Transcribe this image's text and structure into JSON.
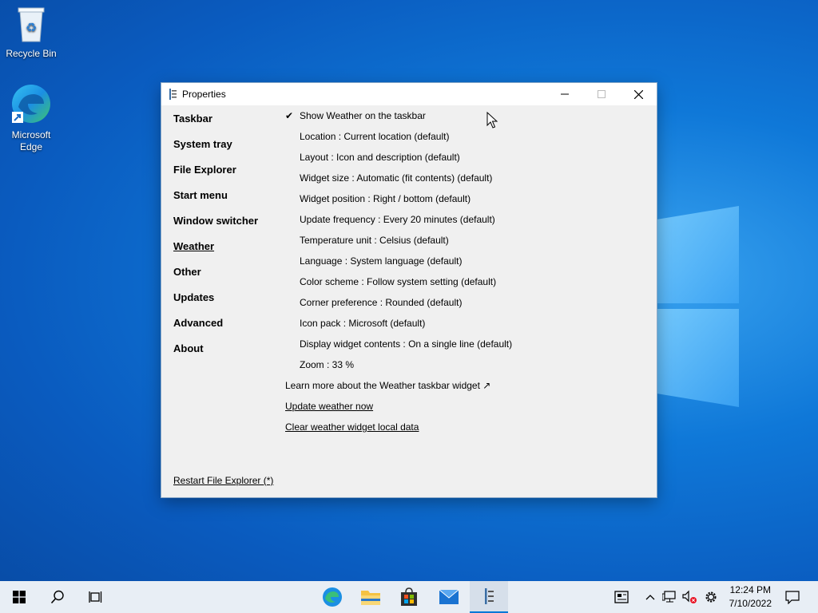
{
  "desktop": {
    "icons": [
      {
        "label": "Recycle Bin"
      },
      {
        "label": "Microsoft Edge",
        "label_line1": "Microsoft",
        "label_line2": "Edge"
      }
    ]
  },
  "window": {
    "title": "Properties",
    "nav": [
      {
        "label": "Taskbar"
      },
      {
        "label": "System tray"
      },
      {
        "label": "File Explorer"
      },
      {
        "label": "Start menu"
      },
      {
        "label": "Window switcher"
      },
      {
        "label": "Weather",
        "active": true
      },
      {
        "label": "Other"
      },
      {
        "label": "Updates"
      },
      {
        "label": "Advanced"
      },
      {
        "label": "About"
      }
    ],
    "options": [
      {
        "check": "✔",
        "label": "Show Weather on the taskbar"
      },
      {
        "label": "Location : Current location (default)"
      },
      {
        "label": "Layout : Icon and description (default)"
      },
      {
        "label": "Widget size : Automatic (fit contents) (default)"
      },
      {
        "label": "Widget position : Right / bottom (default)"
      },
      {
        "label": "Update frequency : Every 20 minutes (default)"
      },
      {
        "label": "Temperature unit : Celsius (default)"
      },
      {
        "label": "Language : System language (default)"
      },
      {
        "label": "Color scheme : Follow system setting (default)"
      },
      {
        "label": "Corner preference : Rounded (default)"
      },
      {
        "label": "Icon pack : Microsoft (default)"
      },
      {
        "label": "Display widget contents : On a single line (default)"
      },
      {
        "label": "Zoom : 33 %"
      }
    ],
    "links": {
      "learn_more": "Learn more about the Weather taskbar widget ↗",
      "update_now": "Update weather now",
      "clear_data": "Clear weather widget local data"
    },
    "restart_link": "Restart File Explorer (*)"
  },
  "taskbar": {
    "time": "12:24 PM",
    "date": "7/10/2022",
    "pinned": [
      "edge-icon",
      "file-explorer-icon",
      "store-icon",
      "mail-icon",
      "properties-app-icon"
    ]
  },
  "colors": {
    "desktop": "#0f78d8",
    "window_bg": "#f0f0f0",
    "taskbar_bg": "#e8eef5",
    "accent": "#0078d7"
  }
}
